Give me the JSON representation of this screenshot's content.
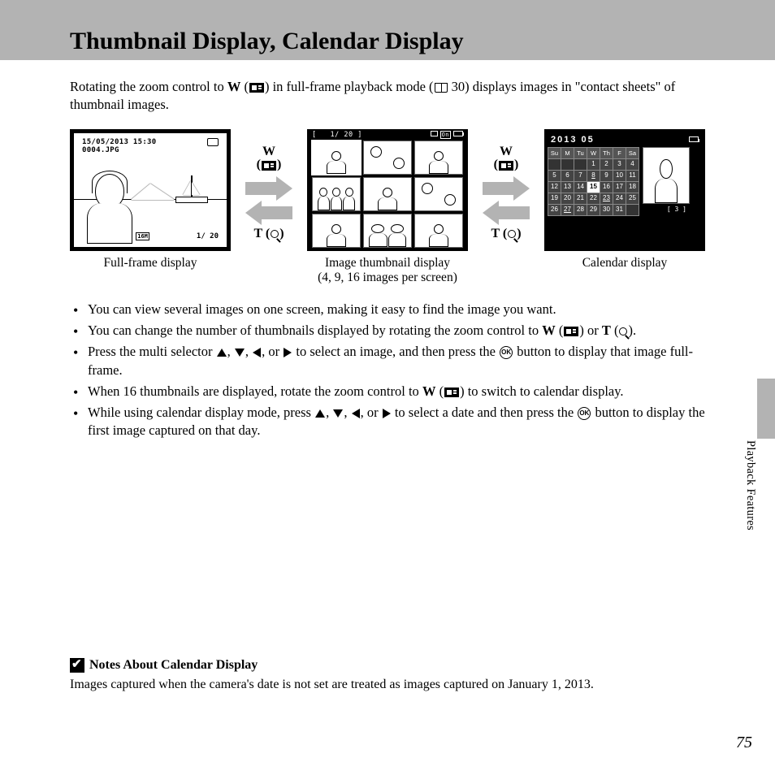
{
  "header": {
    "title": "Thumbnail Display, Calendar Display"
  },
  "intro": {
    "part1": "Rotating the zoom control to ",
    "w": "W",
    "part2": " in full-frame playback mode (",
    "ref": " 30) displays images in \"contact sheets\" of thumbnail images."
  },
  "figures": {
    "full": {
      "timestamp": "15/05/2013 15:30",
      "filename": "0004.JPG",
      "counter": "1/   20",
      "size": "16M",
      "caption": "Full-frame display"
    },
    "arrow_labels": {
      "w": "W",
      "t": "T"
    },
    "thumb": {
      "counter_l": "1/   20",
      "caption1": "Image thumbnail display",
      "caption2": "(4, 9, 16 images per screen)"
    },
    "cal": {
      "title": "2013 05",
      "days": [
        "Su",
        "M",
        "Tu",
        "W",
        "Th",
        "F",
        "Sa"
      ],
      "rows": [
        [
          "",
          "",
          "",
          "1",
          "2",
          "3",
          "4"
        ],
        [
          "5",
          "6",
          "7",
          "8",
          "9",
          "10",
          "11"
        ],
        [
          "12",
          "13",
          "14",
          "15",
          "16",
          "17",
          "18"
        ],
        [
          "19",
          "20",
          "21",
          "22",
          "23",
          "24",
          "25"
        ],
        [
          "26",
          "27",
          "28",
          "29",
          "30",
          "31",
          ""
        ]
      ],
      "has_images": [
        "8",
        "15",
        "23",
        "27"
      ],
      "selected": "15",
      "count": "[      3 ]",
      "caption": "Calendar display"
    }
  },
  "bullets": {
    "b1": "You can view several images on one screen, making it easy to find the image you want.",
    "b2a": "You can change the number of thumbnails displayed by rotating the zoom control to ",
    "b2w": "W",
    "b2or": " or ",
    "b2t": "T",
    "b2end": ".",
    "b3a": "Press the multi selector ",
    "b3mid": ", or ",
    "b3b": " to select an image, and then press the ",
    "b3c": " button to display that image full-frame.",
    "b4a": "When 16 thumbnails are displayed, rotate the zoom control to ",
    "b4w": "W",
    "b4b": " to switch to calendar display.",
    "b5a": "While using calendar display mode, press ",
    "b5mid": ", or ",
    "b5b": " to select a date and then press the ",
    "b5c": " button to display the first image captured on that day."
  },
  "side": {
    "label": "Playback Features"
  },
  "notes": {
    "title": "Notes About Calendar Display",
    "body": "Images captured when the camera's date is not set are treated as images captured on January 1, 2013."
  },
  "page": "75",
  "ok_label": "OK"
}
